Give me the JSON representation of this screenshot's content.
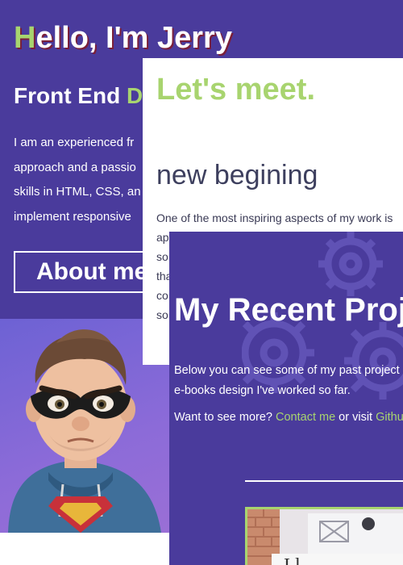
{
  "hero": {
    "title_first_letter": "H",
    "title_rest": "ello, I'm Jerry",
    "subtitle_main": "Front End ",
    "subtitle_accent": "D",
    "intro_lines": [
      "I am an experienced fr",
      "approach and a passio",
      "skills in HTML, CSS, an",
      "implement responsive"
    ],
    "about_button": "About me"
  },
  "meet": {
    "title": "Let's meet.",
    "subtitle": "new begining",
    "text_lines": [
      "One of the most inspiring aspects of my work is",
      "ap",
      "so",
      "tha",
      "co",
      "so"
    ]
  },
  "projects": {
    "title": "My Recent Proj",
    "desc_lines": [
      "Below you can see some of my past project",
      "e-books design I've worked so far."
    ],
    "more_prefix": "Want to see more? ",
    "contact_link": "Contact me",
    "more_middle": " or visit ",
    "github_link": "Githu",
    "thumb_text": "I l"
  },
  "colors": {
    "primary": "#4a3b9c",
    "accent": "#a8d46f",
    "text_dark": "#3d3f5e"
  }
}
